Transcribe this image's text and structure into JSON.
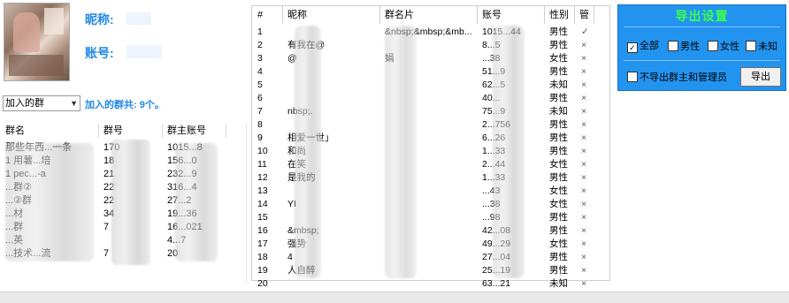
{
  "profile": {
    "nickname_label": "昵称:",
    "account_label": "账号:"
  },
  "group_filter": {
    "selected": "加入的群",
    "count_text": "加入的群共: 9个。"
  },
  "group_table": {
    "columns": [
      "群名",
      "群号",
      "群主账号"
    ],
    "rows": [
      {
        "name": "那些年西...一条",
        "number": "170",
        "owner": "1015...8"
      },
      {
        "name": "1 用薯...培",
        "number": "18",
        "owner": "156...0"
      },
      {
        "name": "1 pec...-a",
        "number": "21",
        "owner": "232...9"
      },
      {
        "name": "...群②",
        "number": "22",
        "owner": "316...4"
      },
      {
        "name": "...②群",
        "number": "22",
        "owner": "27...2"
      },
      {
        "name": "...材",
        "number": "34",
        "owner": "19...36"
      },
      {
        "name": "...群",
        "number": "7",
        "owner": "16...021"
      },
      {
        "name": "...英",
        "number": "",
        "owner": "4...7"
      },
      {
        "name": "...技术...流",
        "number": "7",
        "owner": "20"
      }
    ]
  },
  "member_table": {
    "columns": [
      "#",
      "昵称",
      "群名片",
      "账号",
      "性别",
      "管"
    ],
    "rows": [
      {
        "i": "1",
        "nick": "",
        "card": "&nbsp;&mbsp;&mb...",
        "acct": "1015...44",
        "sex": "男性",
        "admin": "✓"
      },
      {
        "i": "2",
        "nick": "有我在@",
        "card": "",
        "acct": "8...5",
        "sex": "男性",
        "admin": "×"
      },
      {
        "i": "3",
        "nick": "@",
        "card": "娟",
        "acct": "...38",
        "sex": "女性",
        "admin": "×"
      },
      {
        "i": "4",
        "nick": "",
        "card": "",
        "acct": "51...9",
        "sex": "男性",
        "admin": "×"
      },
      {
        "i": "5",
        "nick": "",
        "card": "",
        "acct": "62...5",
        "sex": "未知",
        "admin": "×"
      },
      {
        "i": "6",
        "nick": "",
        "card": "",
        "acct": "40...",
        "sex": "男性",
        "admin": "×"
      },
      {
        "i": "7",
        "nick": "nbsp;.",
        "card": "",
        "acct": "75...9",
        "sex": "未知",
        "admin": "×"
      },
      {
        "i": "8",
        "nick": "",
        "card": "",
        "acct": "2...756",
        "sex": "男性",
        "admin": "×"
      },
      {
        "i": "9",
        "nick": "相爱一世」",
        "card": "",
        "acct": "6...26",
        "sex": "男性",
        "admin": "×"
      },
      {
        "i": "10",
        "nick": "和尚",
        "card": "",
        "acct": "1...33",
        "sex": "男性",
        "admin": "×"
      },
      {
        "i": "11",
        "nick": "在笑",
        "card": "",
        "acct": "2...44",
        "sex": "女性",
        "admin": "×"
      },
      {
        "i": "12",
        "nick": "是我的",
        "card": "",
        "acct": "1...33",
        "sex": "男性",
        "admin": "×"
      },
      {
        "i": "13",
        "nick": "",
        "card": "",
        "acct": "...43",
        "sex": "女性",
        "admin": "×"
      },
      {
        "i": "14",
        "nick": "YI",
        "card": "",
        "acct": "...38",
        "sex": "女性",
        "admin": "×"
      },
      {
        "i": "15",
        "nick": "",
        "card": "",
        "acct": "...98",
        "sex": "男性",
        "admin": "×"
      },
      {
        "i": "16",
        "nick": "&mbsp;",
        "card": "",
        "acct": "42...08",
        "sex": "男性",
        "admin": "×"
      },
      {
        "i": "17",
        "nick": "强势",
        "card": "",
        "acct": "49...29",
        "sex": "女性",
        "admin": "×"
      },
      {
        "i": "18",
        "nick": "4",
        "card": "",
        "acct": "27...04",
        "sex": "男性",
        "admin": "×"
      },
      {
        "i": "19",
        "nick": "人自醉",
        "card": "",
        "acct": "25...19",
        "sex": "男性",
        "admin": "×"
      },
      {
        "i": "20",
        "nick": "",
        "card": "",
        "acct": "63...21",
        "sex": "未知",
        "admin": "×"
      }
    ]
  },
  "export_panel": {
    "title": "导出设置",
    "all": "全部",
    "male": "男性",
    "female": "女性",
    "unknown": "未知",
    "exclude": "不导出群主和管理员",
    "export_button": "导出",
    "all_checked": true
  }
}
